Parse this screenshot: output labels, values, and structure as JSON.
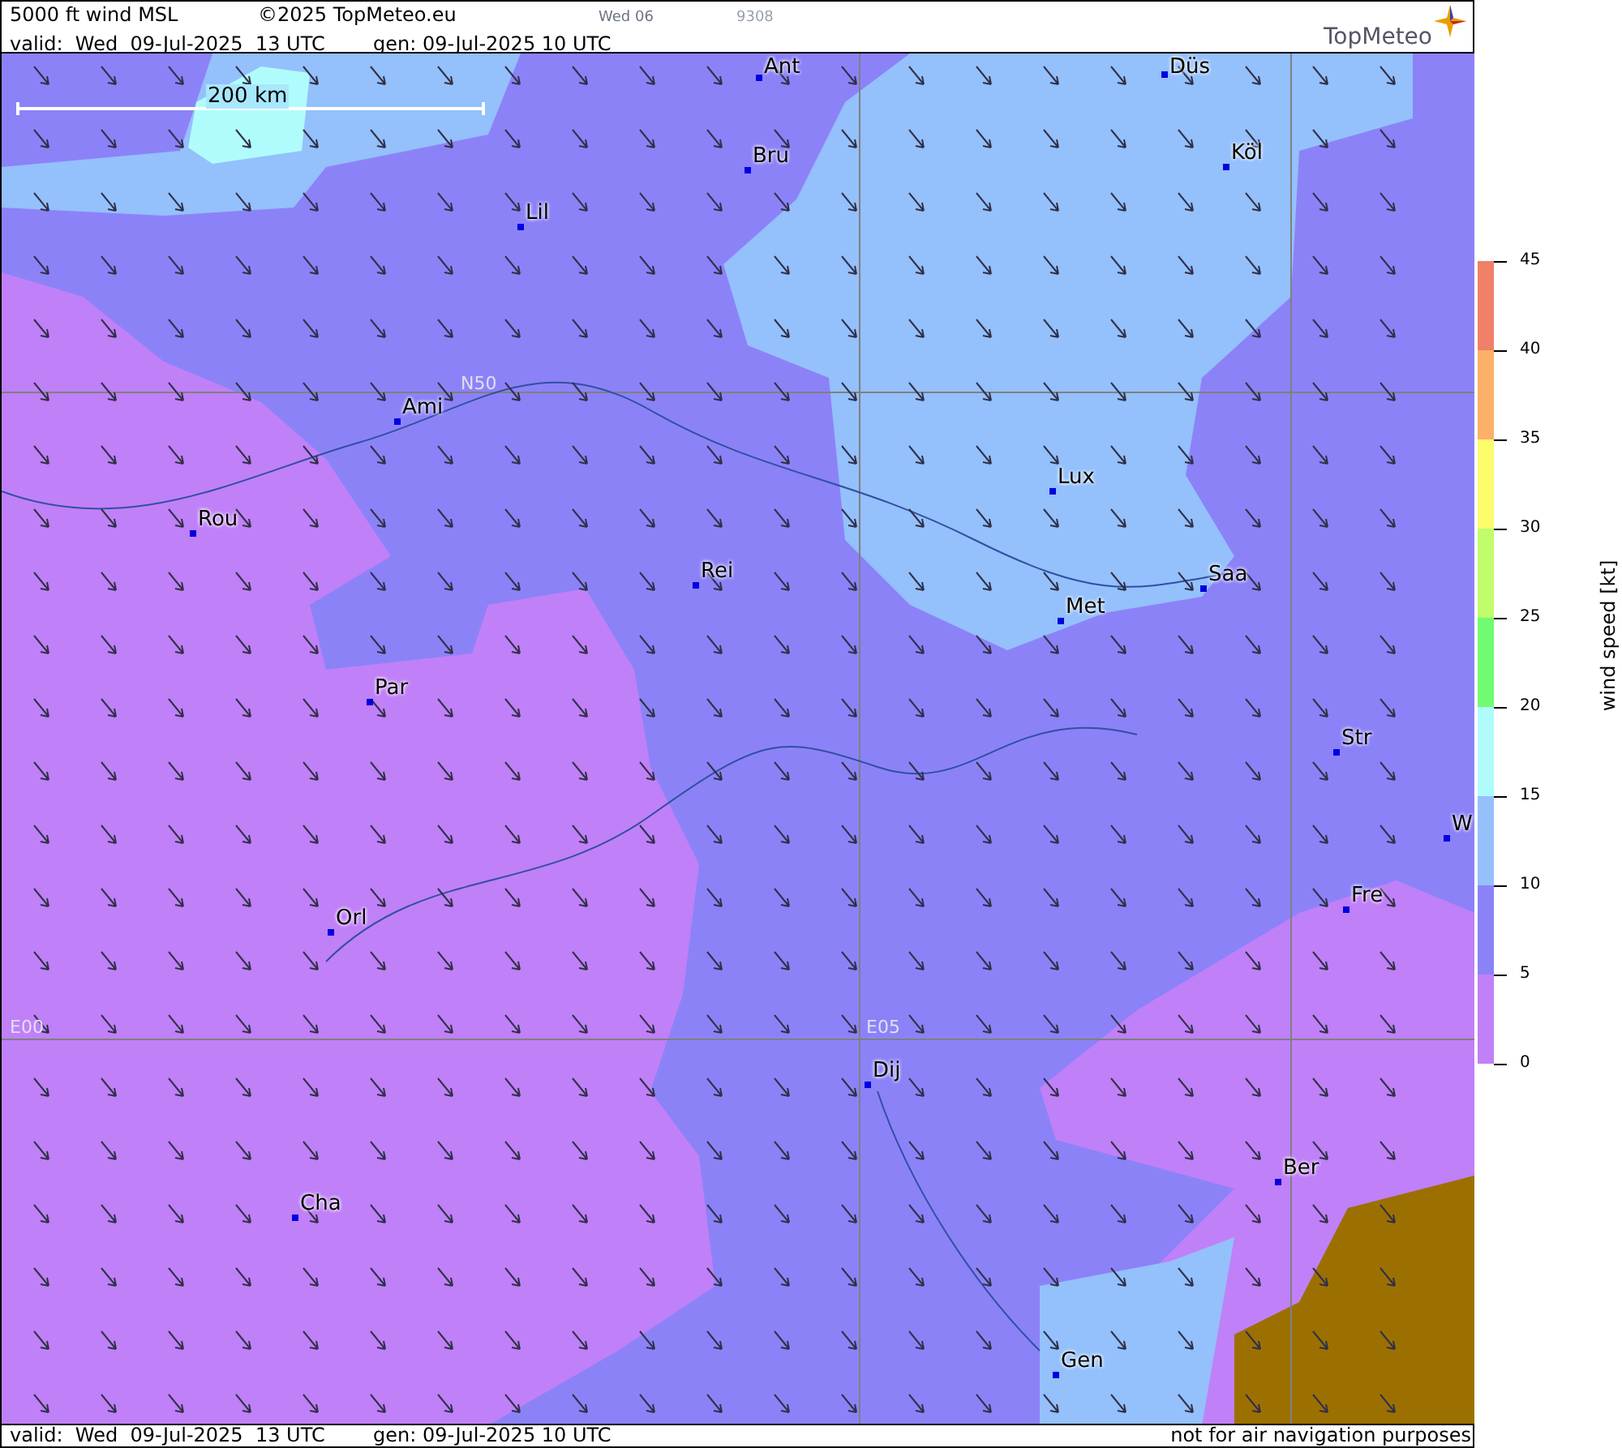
{
  "header": {
    "title": "5000 ft wind MSL",
    "copyright": "©2025 TopMeteo.eu",
    "run_day": "Wed 06",
    "code": "9308",
    "valid": "valid:  Wed  09-Jul-2025  13 UTC",
    "generated": "gen: 09-Jul-2025 10 UTC",
    "logo": "TopMeteo"
  },
  "map": {
    "scale_label": "200 km",
    "grid_labels": [
      "N50",
      "E00",
      "E05"
    ],
    "cities": [
      "Ant",
      "Düs",
      "Bru",
      "Köl",
      "Lil",
      "Ami",
      "Lux",
      "Rou",
      "Rei",
      "Saa",
      "Met",
      "Par",
      "Str",
      "W",
      "Fre",
      "Orl",
      "Dij",
      "Ber",
      "Cha",
      "Gen"
    ]
  },
  "legend": {
    "title": "wind speed [kt]",
    "bands": [
      {
        "color": "#f08068"
      },
      {
        "color": "#fcb068"
      },
      {
        "color": "#fcfc6c"
      },
      {
        "color": "#c0fc6c"
      },
      {
        "color": "#70fc70"
      },
      {
        "color": "#b0fcfc"
      },
      {
        "color": "#94c0fc"
      },
      {
        "color": "#8c82f8"
      },
      {
        "color": "#c080f8"
      }
    ],
    "ticks": [
      "45",
      "40",
      "35",
      "30",
      "25",
      "20",
      "15",
      "10",
      "5",
      "0"
    ]
  },
  "footer": {
    "valid": "valid:  Wed  09-Jul-2025  13 UTC",
    "generated": "gen: 09-Jul-2025 10 UTC",
    "disclaimer": "not for air navigation purposes"
  }
}
